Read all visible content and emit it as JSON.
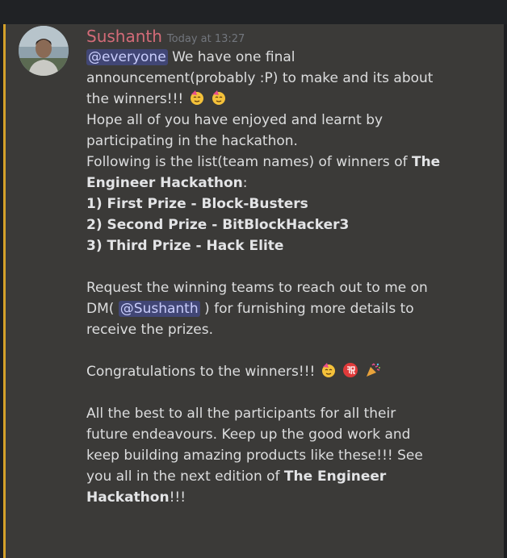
{
  "message": {
    "author": "Sushanth",
    "timestamp": "Today at 13:27",
    "mention_everyone": "@everyone",
    "line1_rest": " We have one final",
    "line2": "announcement(probably :P) to make and its about",
    "line3": "the winners!!!",
    "line4": "Hope all of you have enjoyed and learnt by",
    "line5": "participating in the hackathon.",
    "line6_text": "Following is the list(team names) of winners of ",
    "line6_bold": "The",
    "line7_bold": "Engineer Hackathon",
    "line7_rest": ":",
    "winners": [
      "1) First Prize - Block-Busters",
      "2) Second Prize - BitBlockHacker3",
      "3) Third Prize - Hack Elite"
    ],
    "request_line1": "Request the winning teams to reach out to me on",
    "request_line2_pre": "DM( ",
    "mention_user": "@Sushanth",
    "request_line2_post": " ) for furnishing more details to",
    "request_line3": "receive the prizes.",
    "congrats": "Congratulations to the winners!!!",
    "closing_line1": "All the best to all the participants for all their",
    "closing_line2": "future endeavours. Keep up the good work and",
    "closing_line3": "keep building amazing products like these!!! See",
    "closing_line4_pre": "you all in the next edition of ",
    "closing_line4_bold": "The Engineer",
    "closing_line5_bold": "Hackathon",
    "closing_line5_rest": "!!!",
    "emojis": [
      "partying-face-icon",
      "partying-face-icon",
      "partying-face-icon",
      "congratulations-ideograph-icon",
      "party-popper-icon"
    ]
  },
  "colors": {
    "username": "#d36b78",
    "mention_bg": "#414675",
    "accent_bar": "#d4a12a",
    "panel_bg": "#3b3a38"
  }
}
